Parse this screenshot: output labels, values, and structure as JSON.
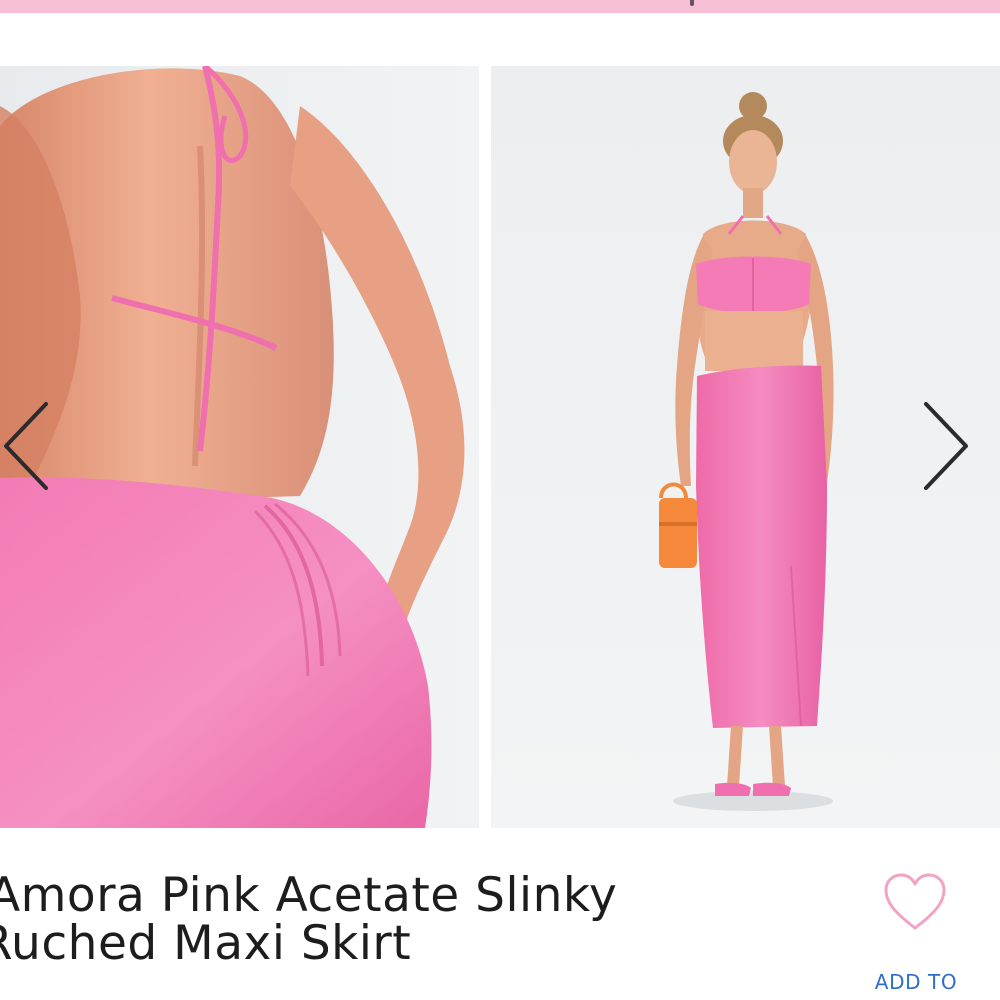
{
  "colors": {
    "brand_pink": "#f6bfd6",
    "heart_outline": "#f2a3c4",
    "link_blue": "#2f6ec9",
    "title_text": "#1d1d1d",
    "garment_pink": "#f06fae"
  },
  "gallery": {
    "images": [
      {
        "subject": "back view of ruched pink maxi skirt with halter top ties"
      },
      {
        "subject": "full-length model wearing pink bandeau top, maxi skirt, orange bag and pink heels"
      }
    ],
    "prev_icon": "chevron-left-icon",
    "next_icon": "chevron-right-icon"
  },
  "product": {
    "title_line_1": "Amora Pink Acetate Slinky",
    "title_line_2": "Ruched Maxi Skirt"
  },
  "wishlist": {
    "icon": "heart-outline-icon",
    "label": "ADD TO"
  }
}
